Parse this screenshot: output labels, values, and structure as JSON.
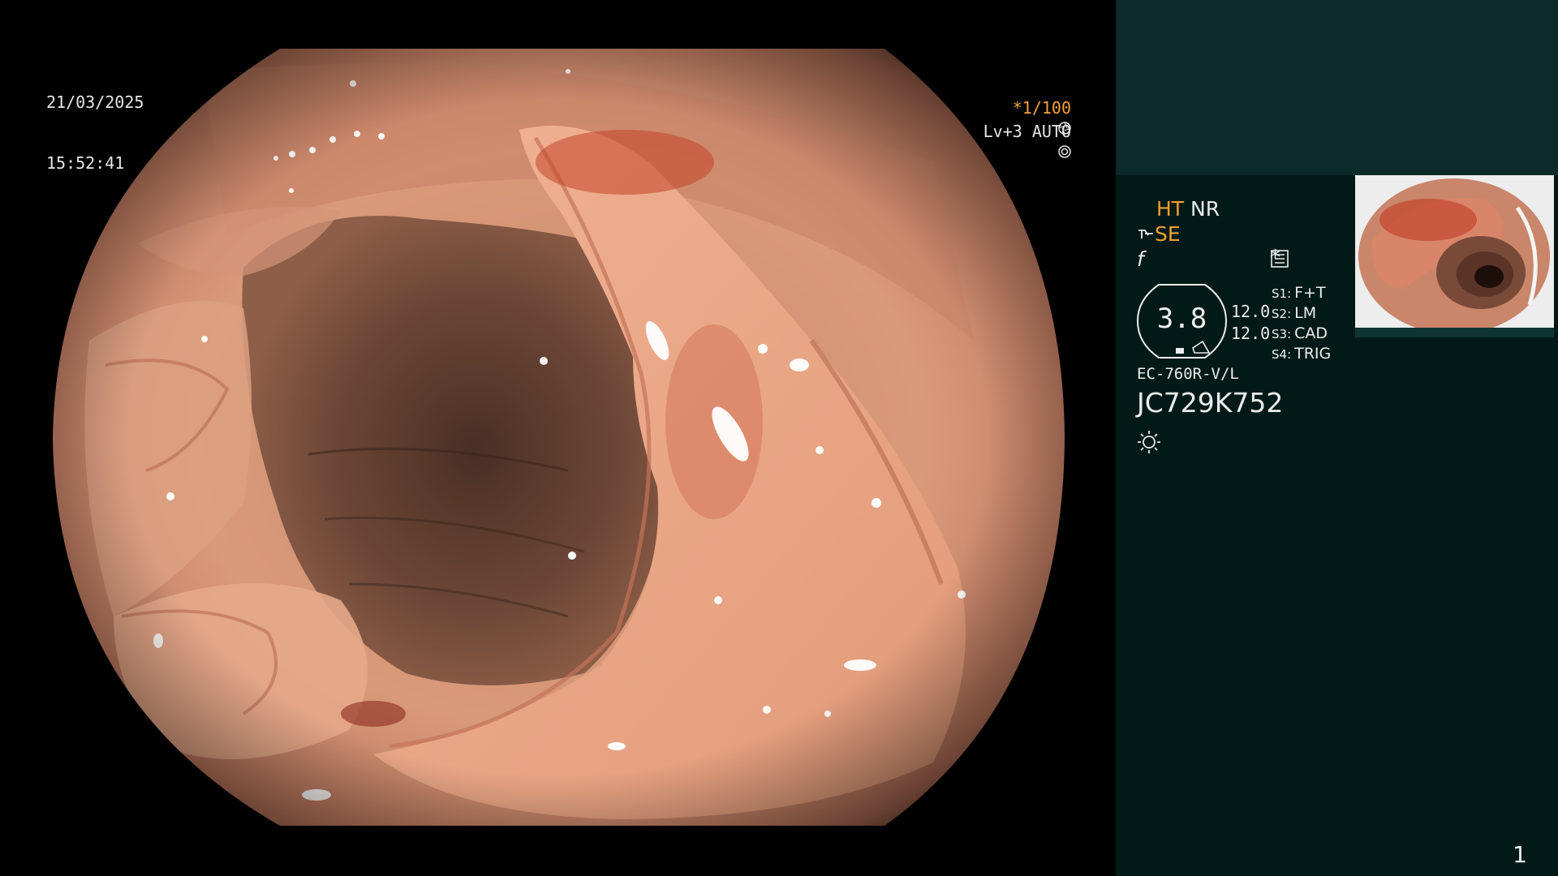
{
  "overlay": {
    "date": "21/03/2025",
    "time": "15:52:41",
    "shutter": "*1/100",
    "shutter_icon": "aperture-icon",
    "level": "Lv+3 AUTO",
    "level_icon": "iris-icon"
  },
  "panel": {
    "ht": "HT",
    "nr": "NR",
    "se": "SE",
    "se_icon": "lens-icon",
    "f_symbol": "f",
    "menu_icon": "menu-icon",
    "asterisk": "*",
    "scope_value": "3.8",
    "value_1": "12.0",
    "value_2": "12.0",
    "switches": [
      {
        "key": "S1:",
        "value": "F+T"
      },
      {
        "key": "S2:",
        "value": "LM"
      },
      {
        "key": "S3:",
        "value": "CAD"
      },
      {
        "key": "S4:",
        "value": "TRIG"
      }
    ],
    "model": "EC-760R-V/L",
    "serial": "JC729K752",
    "light_icon": "light-icon",
    "page": "1"
  },
  "colors": {
    "panel_bg": "#021a17",
    "panel_band": "#0b2a28",
    "accent_orange": "#f0a030",
    "text": "#ececec",
    "tissue": "#e8a07e",
    "lumen": "#5a3a2c"
  }
}
